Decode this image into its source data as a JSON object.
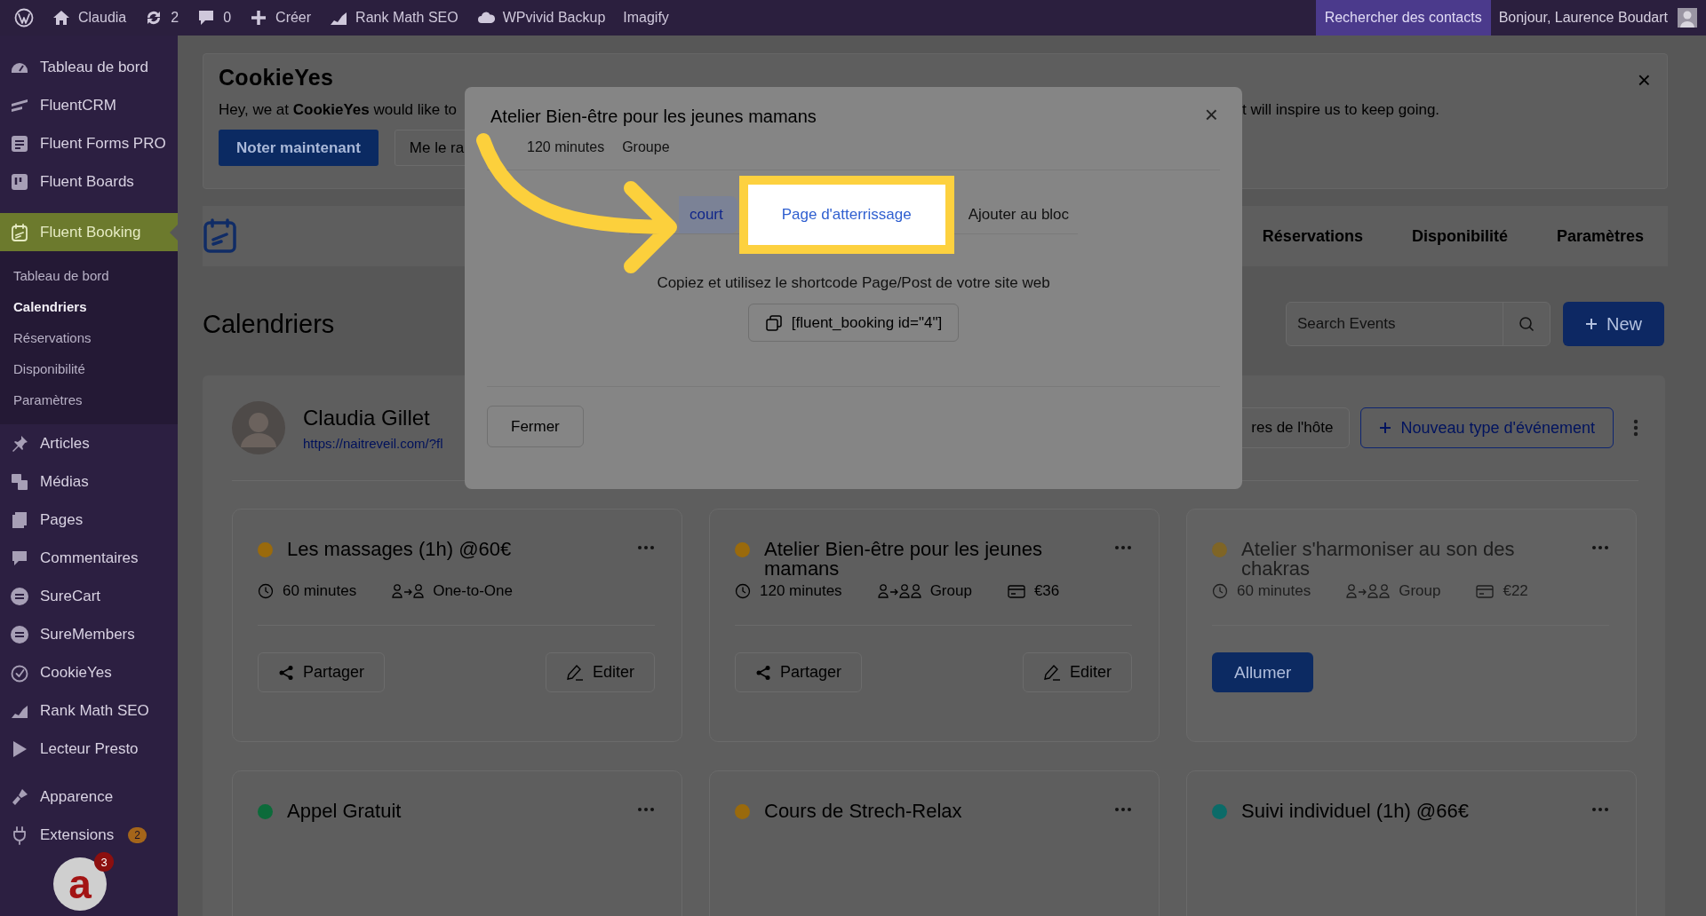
{
  "admin_bar": {
    "items": [
      {
        "kind": "wp"
      },
      {
        "kind": "home",
        "label": "Claudia"
      },
      {
        "kind": "updates",
        "label": "2"
      },
      {
        "kind": "comments",
        "label": "0"
      },
      {
        "kind": "new",
        "label": "Créer"
      },
      {
        "kind": "chart",
        "label": "Rank Math SEO"
      },
      {
        "kind": "cloud",
        "label": "WPvivid Backup"
      },
      {
        "kind": "plain",
        "label": "Imagify"
      }
    ],
    "right": [
      {
        "label": "Rechercher des contacts",
        "highlighted": true
      },
      {
        "label": "Bonjour, Laurence Boudart",
        "highlighted": false
      }
    ]
  },
  "sidebar": {
    "items": [
      {
        "kind": "dashboard",
        "label": "Tableau de bord",
        "current": false
      },
      {
        "kind": "crm",
        "label": "FluentCRM",
        "current": false
      },
      {
        "kind": "forms",
        "label": "Fluent Forms PRO",
        "current": false
      },
      {
        "kind": "boards",
        "label": "Fluent Boards",
        "current": false
      },
      {
        "kind": "booking",
        "label": "Fluent Booking",
        "current": true,
        "children": [
          {
            "label": "Tableau de bord",
            "selected": false
          },
          {
            "label": "Calendriers",
            "selected": true
          },
          {
            "label": "Réservations",
            "selected": false
          },
          {
            "label": "Disponibilité",
            "selected": false
          },
          {
            "label": "Paramètres",
            "selected": false
          }
        ]
      },
      {
        "kind": "posts",
        "label": "Articles",
        "current": false
      },
      {
        "kind": "media",
        "label": "Médias",
        "current": false
      },
      {
        "kind": "pages",
        "label": "Pages",
        "current": false
      },
      {
        "kind": "comments",
        "label": "Commentaires",
        "current": false
      },
      {
        "kind": "stripes",
        "label": "SureCart",
        "current": false
      },
      {
        "kind": "stripes",
        "label": "SureMembers",
        "current": false
      },
      {
        "kind": "cookie",
        "label": "CookieYes",
        "current": false
      },
      {
        "kind": "chart",
        "label": "Rank Math SEO",
        "current": false
      },
      {
        "kind": "play",
        "label": "Lecteur Presto",
        "current": false
      },
      {
        "kind": "separator"
      },
      {
        "kind": "brush",
        "label": "Apparence",
        "current": false
      },
      {
        "kind": "plug",
        "label": "Extensions",
        "current": false,
        "badge": "2"
      }
    ],
    "widget": {
      "logo": "a",
      "badge": "3"
    }
  },
  "notice": {
    "logo": "CookieYes",
    "text": "Hey, we at **CookieYes** would like to",
    "text_after_dialog": "t will inspire us to keep going.",
    "close": "×",
    "buttons": [
      {
        "kind": "primary",
        "label": "Noter maintenant"
      },
      {
        "kind": "secondary",
        "label": "Me le ra"
      }
    ]
  },
  "booking_nav": {
    "tabs": [
      {
        "label": "Réservations",
        "selected": false
      },
      {
        "label": "Disponibilité",
        "selected": false
      },
      {
        "label": "Paramètres",
        "selected": false
      }
    ]
  },
  "page": {
    "title": "Calendriers",
    "search": {
      "placeholder": "Search Events"
    },
    "new_button": "New"
  },
  "host": {
    "name": "Claudia Gillet",
    "link": "https://naitreveil.com/?fl",
    "buttons": [
      {
        "kind": "secondary",
        "label": "res de l'hôte"
      },
      {
        "kind": "outline",
        "label": "Nouveau type d'événement"
      }
    ]
  },
  "event_types": [
    {
      "title": "Les massages (1h) @60€",
      "color": "#9a6a0c",
      "disabled": false,
      "meta": [
        {
          "kind": "duration",
          "text": "60 minutes"
        },
        {
          "kind": "one",
          "text": "One-to-One"
        }
      ],
      "actions": [
        {
          "kind": "share",
          "label": "Partager"
        },
        {
          "kind": "edit",
          "label": "Editer"
        }
      ]
    },
    {
      "title": "Atelier Bien-être pour les jeunes mamans",
      "color": "#9a6a0c",
      "disabled": false,
      "meta": [
        {
          "kind": "duration",
          "text": "120 minutes"
        },
        {
          "kind": "group",
          "text": "Group"
        },
        {
          "kind": "price",
          "text": "€36"
        }
      ],
      "actions": [
        {
          "kind": "share",
          "label": "Partager"
        },
        {
          "kind": "edit",
          "label": "Editer"
        }
      ]
    },
    {
      "title": "Atelier s'harmoniser au son des chakras",
      "color": "#7f6526",
      "disabled": true,
      "meta": [
        {
          "kind": "duration",
          "text": "60 minutes"
        },
        {
          "kind": "group",
          "text": "Group"
        },
        {
          "kind": "price",
          "text": "€22"
        }
      ],
      "actions": [
        {
          "kind": "enable",
          "label": "Allumer"
        }
      ]
    },
    {
      "title": "Appel Gratuit",
      "color": "#0c6b3a",
      "disabled": false
    },
    {
      "title": "Cours de Strech-Relax",
      "color": "#9a6a0c",
      "disabled": false
    },
    {
      "title": "Suivi individuel (1h) @66€",
      "color": "#0b6b68",
      "disabled": false
    }
  ],
  "dialog": {
    "title": "Atelier Bien-être pour les jeunes mamans",
    "meta": [
      "120 minutes",
      "Groupe"
    ],
    "close": "×",
    "tabs": [
      {
        "label": "court",
        "selected": true,
        "highlighted": false
      },
      {
        "label": "Page d'atterrissage",
        "selected": false,
        "highlighted": true
      },
      {
        "label": "Ajouter au bloc",
        "selected": false,
        "highlighted": false
      }
    ],
    "instruction": "Copiez et utilisez le shortcode Page/Post de votre site web",
    "shortcode": "[fluent_booking id=\"4\"]",
    "button": "Fermer"
  }
}
